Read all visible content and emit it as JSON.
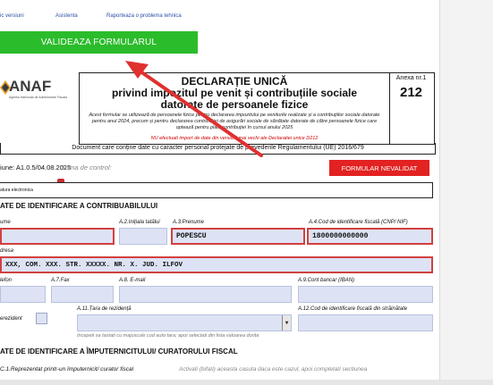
{
  "top_links": {
    "versiuni": "ic versiuni",
    "asistenta": "Asistenta",
    "raporteaza": "Raporteaza o problema tehnica"
  },
  "validate_button": "VALIDEAZA FORMULARUL",
  "logo": {
    "name": "ANAF",
    "subtitle": "Agentia Nationala de Administrare Fiscala"
  },
  "header": {
    "title_line1": "DECLARAȚIE UNICĂ",
    "title_line2": "privind impozitul pe venit și contribuțiile sociale",
    "title_line3": "datorate de persoanele fizice",
    "note": "Acest formular se utilizează de persoanele fizice pentru declararea impozitului pe veniturile realizate și a contribuțiilor sociale datorate pentru anul 2024, precum și pentru declararea contribuției de asigurări sociale de sănătate datorate de către persoanele fizice care optează pentru plata contribuției în cursul anului 2025",
    "warning": "NU efectuati import de date din versiuni mai vechi ale Declaratiei unice D212",
    "annex_label": "Anexa nr.1",
    "annex_number": "212"
  },
  "doc_personal": "Document care conține date cu caracter personal protejate de prevederile Regulamentului (UE) 2016/679",
  "version_text": "iune: A1.0.5/04.08.2025",
  "suma_control": "Suma de control:",
  "status_button": "FORMULAR NEVALIDAT",
  "signature_label": "atura electronica",
  "sectionA": {
    "title": "ATE DE IDENTIFICARE A CONTRIBUABILULUI",
    "labels": {
      "nume": "ume",
      "initiala": "A.2.Inițiala tatălui",
      "prenume": "A.3.Prenume",
      "cnp": "A.4.Cod de identificare fiscală (CNP/ NIF)",
      "adresa": "dresa",
      "telefon": "lefon",
      "fax": "A.7.Fax",
      "email": "A.8. E-mail",
      "cont": "A.9.Cont bancar (IBAN)",
      "nerezident": "erezident",
      "tara": "A.11.Țara de rezidență",
      "cod_strainatate": "A.12.Cod de identificare fiscală din străinătate"
    },
    "values": {
      "prenume": "POPESCU",
      "cnp": "1800000000000",
      "adresa": "XXX, COM. XXX. STR. XXXXX. NR. X. JUD. ILFOV"
    },
    "hint": "Incepeti sa tastati cu majuscule cod auto tara; apoi selectati din lista valoarea dorita"
  },
  "sectionC": {
    "title": "ATE DE IDENTIFICARE A ÎMPUTERNICITULUI/ CURATORULUI FISCAL",
    "c1_label": "C.1.Reprezentat printr-un împuternicit/ curator fiscal",
    "c1_hint": "Activati (bifati) aceasta casuta daca este cazul, apoi completati sectiunea"
  },
  "colors": {
    "validate_green": "#2bbc2b",
    "status_red": "#e32222",
    "field_blue": "#dde3f4",
    "arrow_red": "#e03030"
  }
}
